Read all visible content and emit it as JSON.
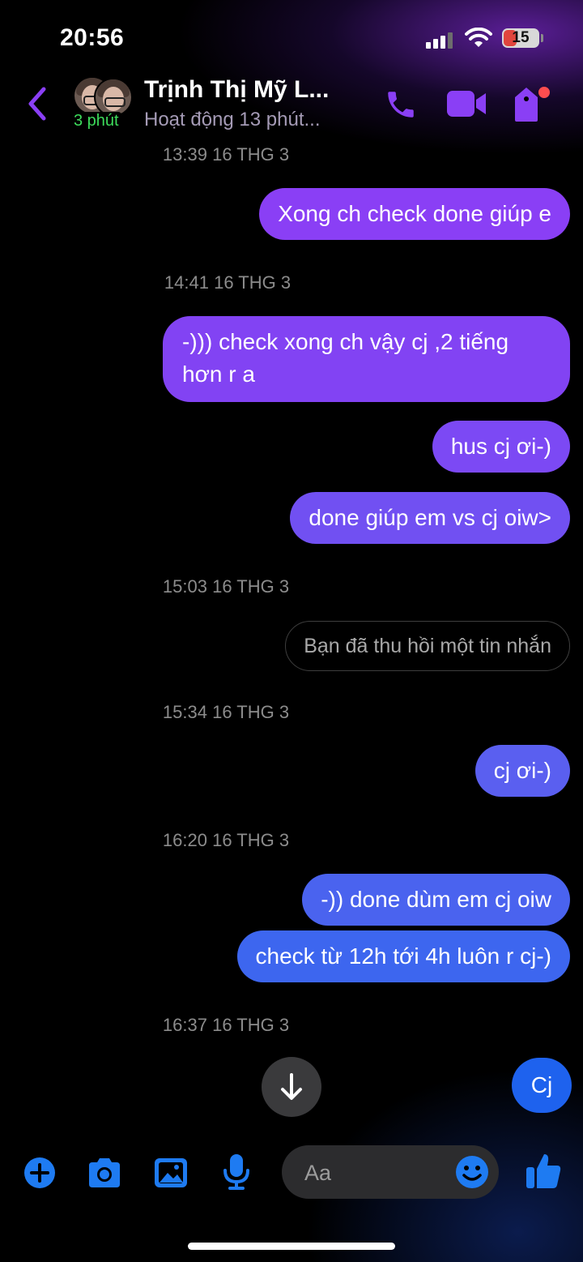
{
  "status_bar": {
    "time": "20:56",
    "battery_level": "15",
    "icons": [
      "signal-icon",
      "wifi-icon",
      "battery-icon"
    ]
  },
  "header": {
    "contact_name": "Trịnh Thị Mỹ L...",
    "contact_status": "Hoạt động 13 phút...",
    "active_badge": "3 phút",
    "icons": [
      "back-chevron-icon",
      "phone-icon",
      "video-icon",
      "tag-icon"
    ],
    "accent_color": "#8a3ff5",
    "notification_dot_color": "#ff4d4f"
  },
  "messages": [
    {
      "kind": "timestamp",
      "text": "13:39 16 THG 3"
    },
    {
      "kind": "sent",
      "text": "Xong ch check done giúp e"
    },
    {
      "kind": "timestamp",
      "text": "14:41 16 THG 3"
    },
    {
      "kind": "sent",
      "text": "-))) check xong ch vậy cj ,2 tiếng hơn r a"
    },
    {
      "kind": "sent",
      "text": "hus cj ơi-)"
    },
    {
      "kind": "sent",
      "text": "done giúp em vs cj oiw>"
    },
    {
      "kind": "timestamp",
      "text": "15:03 16 THG 3"
    },
    {
      "kind": "recalled",
      "text": "Bạn đã thu hồi một tin nhắn"
    },
    {
      "kind": "timestamp",
      "text": "15:34 16 THG 3"
    },
    {
      "kind": "sent",
      "text": "cj ơi-)"
    },
    {
      "kind": "timestamp",
      "text": "16:20 16 THG 3"
    },
    {
      "kind": "sent",
      "text": "-)) done dùm em cj oiw"
    },
    {
      "kind": "sent",
      "text": "check từ 12h tới 4h luôn r cj-)"
    },
    {
      "kind": "timestamp",
      "text": "16:37 16 THG 3"
    }
  ],
  "bubble_colors": [
    "#8a3ff5",
    "#8243f3",
    "#7c49f4",
    "#7150f2",
    "#5a5ff0",
    "#4a63ef",
    "#3d66ef"
  ],
  "scroll_down": {
    "icon": "arrow-down-icon"
  },
  "draft_chip": {
    "label": "Cj",
    "color": "#1e62ee"
  },
  "composer": {
    "placeholder": "Aa",
    "icons": [
      "plus-icon",
      "camera-icon",
      "image-icon",
      "mic-icon",
      "emoji-icon",
      "thumbs-up-icon"
    ],
    "icon_color": "#1e7bf2"
  }
}
